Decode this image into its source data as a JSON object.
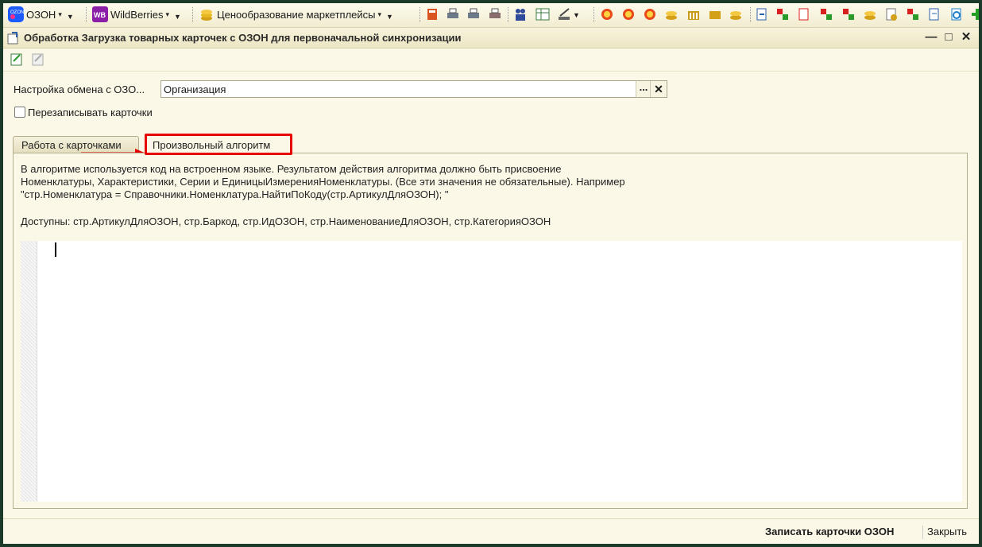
{
  "app_toolbar": {
    "ozon_label": "ОЗОН",
    "wb_label": "WildBerries",
    "pricing_label": "Ценообразование маркетплейсы"
  },
  "window": {
    "title": "Обработка  Загрузка товарных карточек с ОЗОН для первоначальной синхронизации"
  },
  "form": {
    "exchange_label": "Настройка обмена с ОЗО...",
    "exchange_value": "Организация",
    "select_button": "...",
    "clear_button": "✕",
    "overwrite_label": "Перезаписывать карточки",
    "overwrite_checked": false
  },
  "tabs": [
    {
      "label": "Работа с карточками",
      "active": false
    },
    {
      "label": "Произвольный алгоритм",
      "active": true
    }
  ],
  "panel": {
    "description": "В алгоритме используется код на встроенном языке. Результатом действия алгоритма должно быть присвоение\nНоменклатуры, Характеристики, Серии и ЕдиницыИзмеренияНоменклатуры. (Все эти значения не обязательные). Например\n\"стр.Номенклатура = Справочники.Номенклатура.НайтиПоКоду(стр.АртикулДляОЗОН); \"",
    "available": "Доступны: стр.АртикулДляОЗОН, стр.Баркод, стр.ИдОЗОН, стр.НаименованиеДляОЗОН, стр.КатегорияОЗОН",
    "code": ""
  },
  "footer": {
    "write_button": "Записать карточки ОЗОН",
    "close_button": "Закрыть"
  },
  "colors": {
    "highlight": "#e60000",
    "background": "#fbf8e7",
    "frame": "#1c3a2a"
  }
}
